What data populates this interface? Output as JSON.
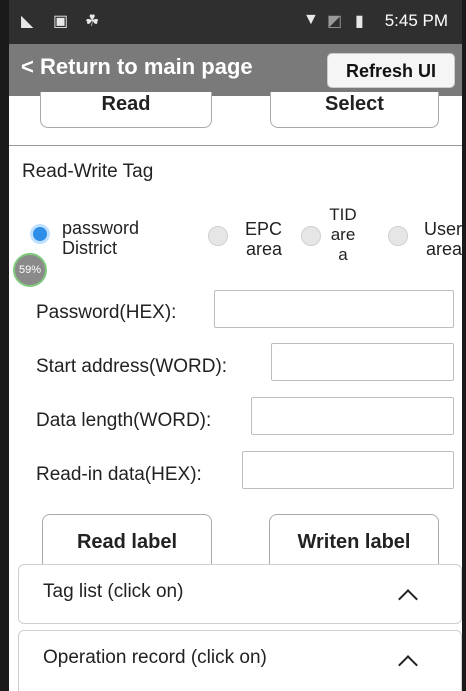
{
  "status_bar": {
    "time": "5:45 PM",
    "icons": [
      "signal-muted-icon",
      "sim-card-icon",
      "android-icon",
      "wifi-icon",
      "no-signal-icon",
      "battery-icon"
    ]
  },
  "app_bar": {
    "back_label": "< Return to main page",
    "refresh_label": "Refresh UI"
  },
  "top_buttons": {
    "read": "Read",
    "select": "Select"
  },
  "section": {
    "title": "Read-Write Tag"
  },
  "area_options": {
    "password_l1": "password",
    "password_l2": "District",
    "epc_l1": "EPC",
    "epc_l2": "area",
    "tid_l1": "TID",
    "tid_l2": "are",
    "tid_l3": "a",
    "user_l1": "User",
    "user_l2": "area",
    "selected": "password District"
  },
  "progress_badge": "59%",
  "fields": {
    "password_label": "Password(HEX):",
    "password_value": "",
    "start_label": "Start address(WORD):",
    "start_value": "",
    "length_label": "Data length(WORD):",
    "length_value": "",
    "data_label": "Read-in data(HEX):",
    "data_value": ""
  },
  "actions": {
    "read_label": "Read label",
    "write_label": "Writen label"
  },
  "panels": {
    "tag_list": "Tag list (click on)",
    "operation_record": "Operation record (click on)"
  },
  "colors": {
    "status_bar": "#2f2f2f",
    "app_bar": "#7a7a7a",
    "radio_selected": "#2e8fe8"
  }
}
